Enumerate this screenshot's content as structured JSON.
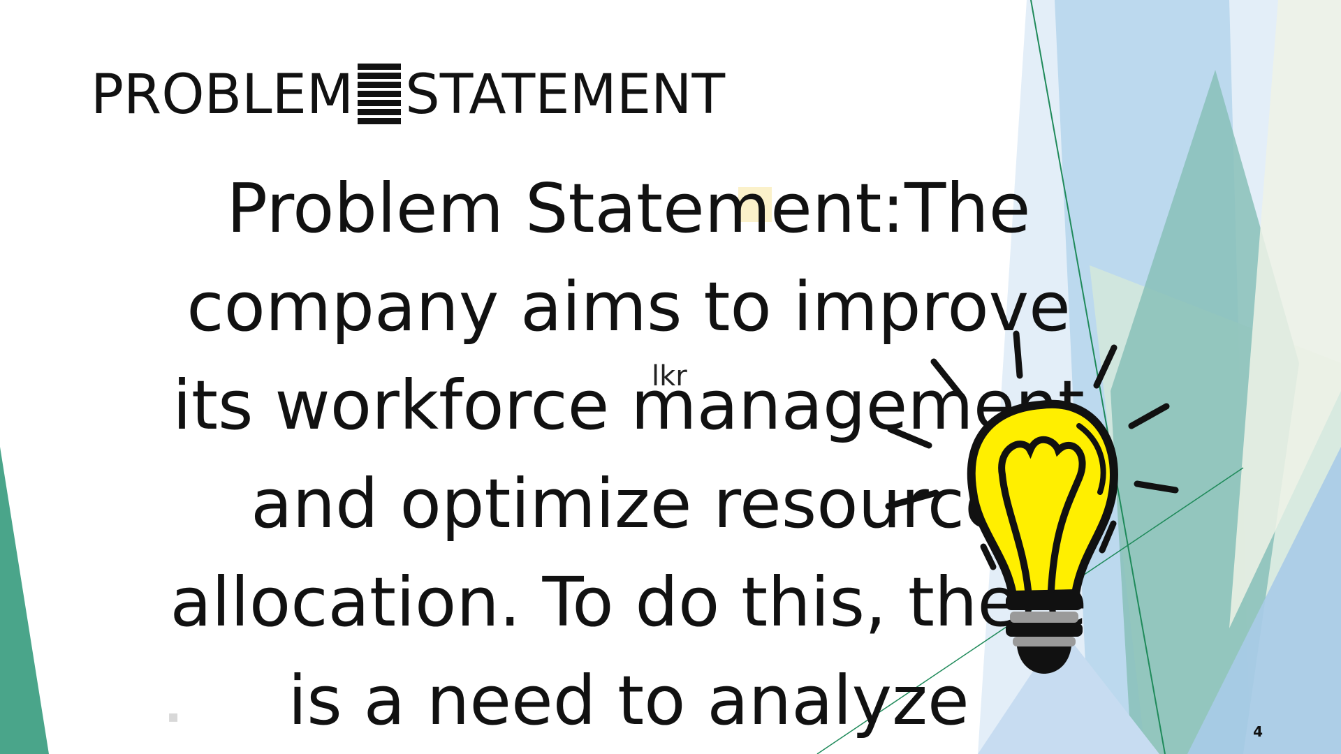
{
  "slide": {
    "heading_left": "PROBLEM",
    "heading_right": "STATEMENT",
    "body": "Problem Statement:The\ncompany aims to improve\nits workforce management\nand optimize resource\nallocation. To do this, there\nis a need to analyze",
    "annotation": "lkr",
    "page_number": "4"
  },
  "icons": {
    "decoration": "lightbulb-icon",
    "heading_bars": "stacked-bars-icon"
  },
  "colors": {
    "teal": "#4aa58a",
    "light_blue": "#bcd9ee",
    "sky_blue": "#a9cbe8",
    "pale_green": "#cfe5d2",
    "bulb_yellow": "#ffef00",
    "text": "#111111"
  }
}
